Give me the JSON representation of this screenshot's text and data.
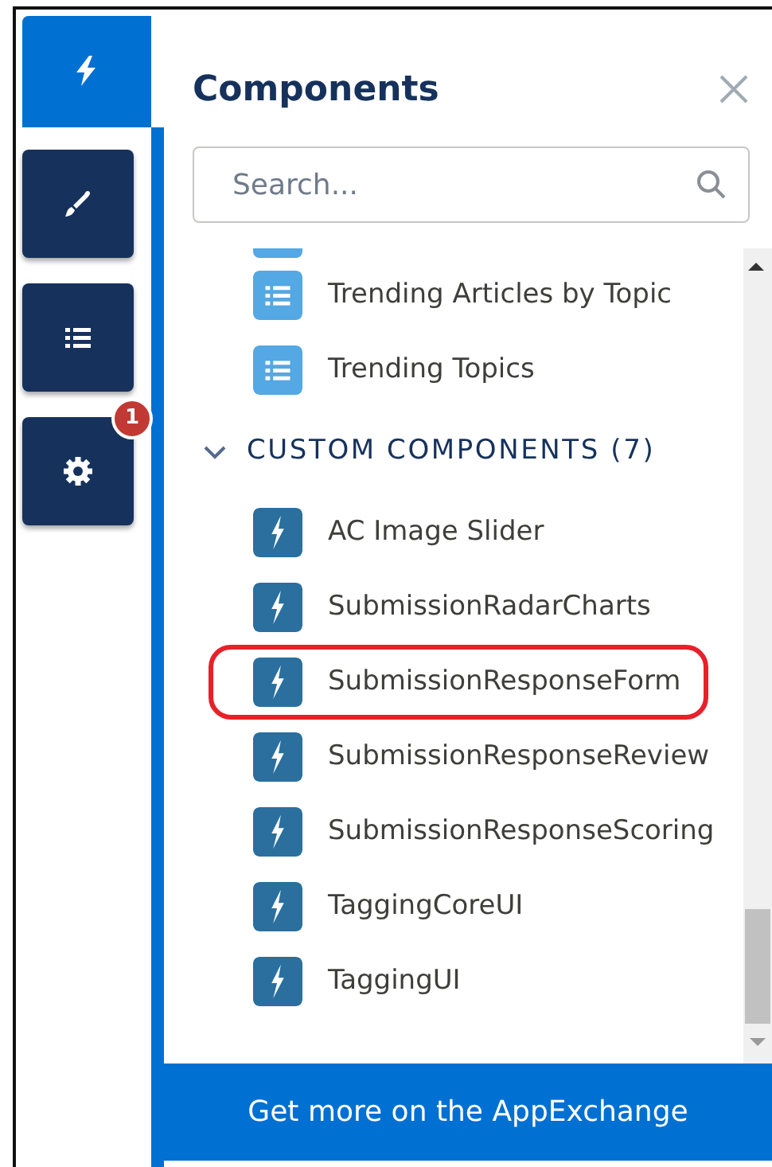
{
  "rail": {
    "tabs": [
      {
        "kind": "lightning",
        "selected": true
      },
      {
        "kind": "brush",
        "selected": false
      },
      {
        "kind": "list",
        "selected": false
      },
      {
        "kind": "gear",
        "selected": false,
        "badge": "1"
      }
    ]
  },
  "panel": {
    "title": "Components",
    "search": {
      "placeholder": "Search..."
    },
    "items": [
      {
        "kind": "list",
        "label": "Trending Articles by Topic",
        "highlighted": false
      },
      {
        "kind": "list",
        "label": "Trending Topics",
        "highlighted": false
      },
      {
        "kind": "section",
        "label": "CUSTOM COMPONENTS (7)",
        "expanded": true
      },
      {
        "kind": "lightning",
        "label": "AC Image Slider",
        "highlighted": false
      },
      {
        "kind": "lightning",
        "label": "SubmissionRadarCharts",
        "highlighted": false
      },
      {
        "kind": "lightning",
        "label": "SubmissionResponseForm",
        "highlighted": true
      },
      {
        "kind": "lightning",
        "label": "SubmissionResponseReview",
        "highlighted": false
      },
      {
        "kind": "lightning",
        "label": "SubmissionResponseScoring",
        "highlighted": false
      },
      {
        "kind": "lightning",
        "label": "TaggingCoreUI",
        "highlighted": false
      },
      {
        "kind": "lightning",
        "label": "TaggingUI",
        "highlighted": false
      }
    ],
    "footer": "Get more on the AppExchange"
  }
}
